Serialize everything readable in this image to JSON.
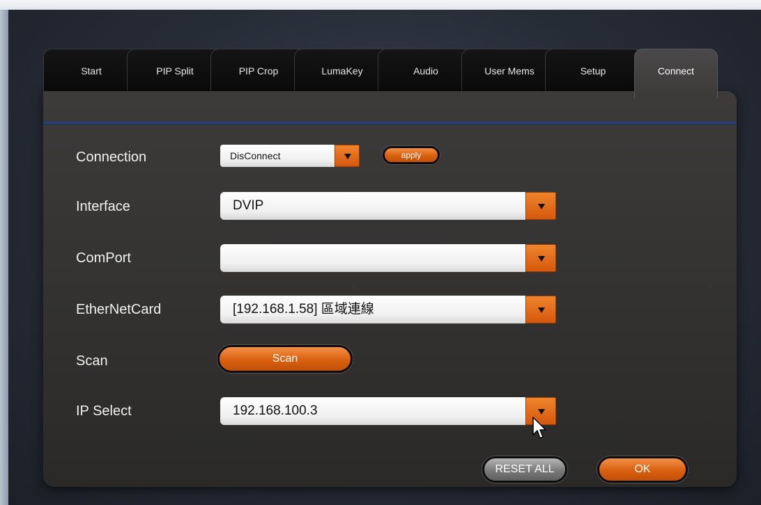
{
  "tabs": [
    {
      "label": "Start"
    },
    {
      "label": "PIP Split"
    },
    {
      "label": "PIP Crop"
    },
    {
      "label": "LumaKey"
    },
    {
      "label": "Audio"
    },
    {
      "label": "User Mems"
    },
    {
      "label": "Setup"
    },
    {
      "label": "Connect",
      "active": true
    }
  ],
  "form": {
    "connection": {
      "label": "Connection",
      "value": "DisConnect",
      "apply_label": "apply"
    },
    "interface": {
      "label": "Interface",
      "value": "DVIP"
    },
    "comport": {
      "label": "ComPort",
      "value": ""
    },
    "ethernet": {
      "label": "EtherNetCard",
      "value": "[192.168.1.58] 區域連線"
    },
    "scan": {
      "label": "Scan",
      "button_label": "Scan"
    },
    "ip_select": {
      "label": "IP Select",
      "value": "192.168.100.3"
    }
  },
  "footer": {
    "reset_label": "RESET ALL",
    "ok_label": "OK"
  },
  "colors": {
    "accent_orange": "#e0661a",
    "divider_blue": "#2d4a8a",
    "panel": "#363534"
  }
}
